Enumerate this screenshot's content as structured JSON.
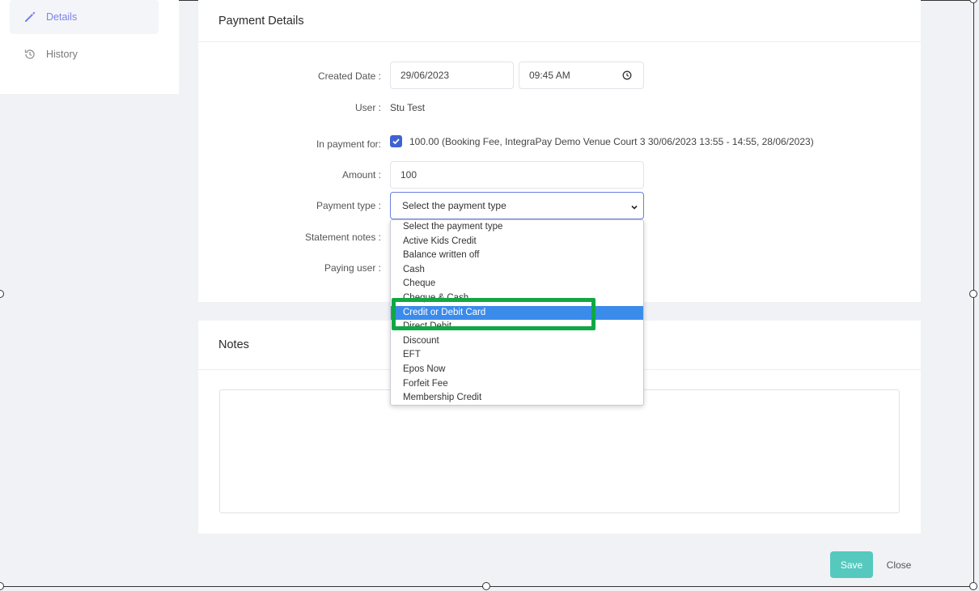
{
  "sidebar": {
    "items": [
      {
        "label": "Details",
        "icon": "pencil-icon",
        "active": true
      },
      {
        "label": "History",
        "icon": "history-icon",
        "active": false
      }
    ]
  },
  "payment_details": {
    "title": "Payment Details",
    "created_date": {
      "label": "Created Date :",
      "date": "29/06/2023",
      "time": "09:45 AM"
    },
    "user": {
      "label": "User :",
      "value": "Stu Test"
    },
    "in_payment_for": {
      "label": "In payment for:",
      "checked": true,
      "value": "100.00 (Booking Fee, IntegraPay Demo Venue Court 3 30/06/2023 13:55 - 14:55, 28/06/2023)"
    },
    "amount": {
      "label": "Amount :",
      "value": "100"
    },
    "payment_type": {
      "label": "Payment type :",
      "selected": "Select the payment type",
      "options": [
        "Select the payment type",
        "Active Kids Credit",
        "Balance written off",
        "Cash",
        "Cheque",
        "Cheque & Cash",
        "Credit or Debit Card",
        "Direct Debit",
        "Discount",
        "EFT",
        "Epos Now",
        "Forfeit Fee",
        "Membership Credit"
      ],
      "highlighted": "Credit or Debit Card"
    },
    "statement_notes": {
      "label": "Statement notes :"
    },
    "paying_user": {
      "label": "Paying user :"
    }
  },
  "notes": {
    "title": "Notes",
    "value": ""
  },
  "footer": {
    "save_label": "Save",
    "close_label": "Close"
  },
  "colors": {
    "accent": "#7b83eb",
    "save_button": "#56c9bf",
    "highlight": "#3b8beb",
    "annotation": "#10a844",
    "checkbox": "#3f63d3"
  }
}
